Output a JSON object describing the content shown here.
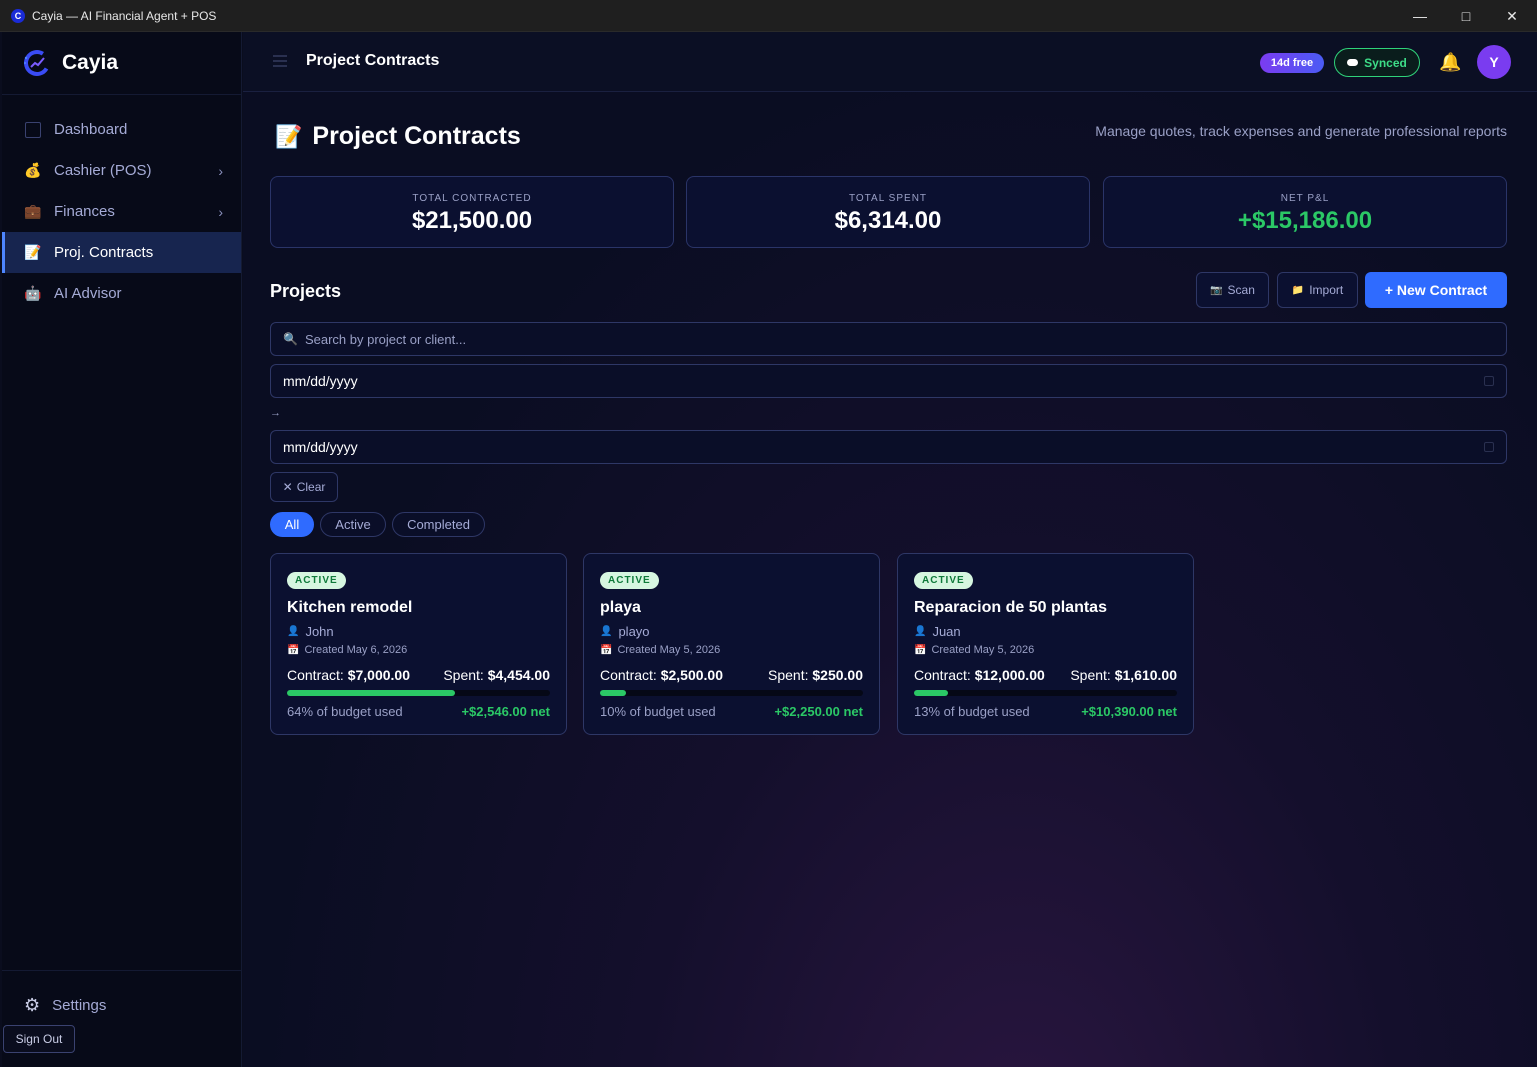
{
  "window": {
    "title": "Cayia — AI Financial Agent + POS",
    "icon_letter": "C",
    "controls": [
      "minimize-icon",
      "maximize-icon",
      "close-icon"
    ]
  },
  "sidebar": {
    "brand": "Cayia",
    "items": [
      {
        "label": "Dashboard",
        "icon": "dashboard-icon",
        "active": false,
        "has_submenu": false
      },
      {
        "label": "Cashier (POS)",
        "icon": "money-bag-icon",
        "active": false,
        "has_submenu": true
      },
      {
        "label": "Finances",
        "icon": "briefcase-icon",
        "active": false,
        "has_submenu": true
      },
      {
        "label": "Proj. Contracts",
        "icon": "memo-icon",
        "active": true,
        "has_submenu": false
      },
      {
        "label": "AI Advisor",
        "icon": "robot-icon",
        "active": false,
        "has_submenu": false
      }
    ],
    "settings_label": "Settings",
    "sign_out_label": "Sign Out"
  },
  "topbar": {
    "title": "Project Contracts",
    "trial_badge": "14d free",
    "sync_status": "Synced",
    "avatar_initial": "Y"
  },
  "page": {
    "title": "Project Contracts",
    "subtitle": "Manage quotes, track expenses and generate professional reports"
  },
  "stats": [
    {
      "label": "TOTAL CONTRACTED",
      "value": "$21,500.00",
      "positive": false
    },
    {
      "label": "TOTAL SPENT",
      "value": "$6,314.00",
      "positive": false
    },
    {
      "label": "NET P&L",
      "value": "+$15,186.00",
      "positive": true
    }
  ],
  "projects": {
    "heading": "Projects",
    "scan_label": "Scan",
    "import_label": "Import",
    "new_label": "+ New Contract",
    "search_placeholder": "Search by project or client...",
    "date_from": "mm/dd/yyyy",
    "date_sep": "→",
    "date_to": "mm/dd/yyyy",
    "clear_label": "Clear",
    "filters": [
      {
        "label": "All",
        "selected": true
      },
      {
        "label": "Active",
        "selected": false
      },
      {
        "label": "Completed",
        "selected": false
      }
    ],
    "cards": [
      {
        "status": "ACTIVE",
        "title": "Kitchen remodel",
        "client": "John",
        "created": "Created May 6, 2026",
        "contract_label": "Contract:",
        "contract": "$7,000.00",
        "spent_label": "Spent:",
        "spent": "$4,454.00",
        "budget_used_pct": 64,
        "used_text": "64% of budget used",
        "net": "+$2,546.00 net"
      },
      {
        "status": "ACTIVE",
        "title": "playa",
        "client": "playo",
        "created": "Created May 5, 2026",
        "contract_label": "Contract:",
        "contract": "$2,500.00",
        "spent_label": "Spent:",
        "spent": "$250.00",
        "budget_used_pct": 10,
        "used_text": "10% of budget used",
        "net": "+$2,250.00 net"
      },
      {
        "status": "ACTIVE",
        "title": "Reparacion de 50 plantas",
        "client": "Juan",
        "created": "Created May 5, 2026",
        "contract_label": "Contract:",
        "contract": "$12,000.00",
        "spent_label": "Spent:",
        "spent": "$1,610.00",
        "budget_used_pct": 13,
        "used_text": "13% of budget used",
        "net": "+$10,390.00 net"
      }
    ]
  },
  "colors": {
    "accent": "#2f6bff",
    "positive": "#2bc866",
    "sidebar_bg": "#070a18",
    "main_bg": "#0a0d22"
  }
}
